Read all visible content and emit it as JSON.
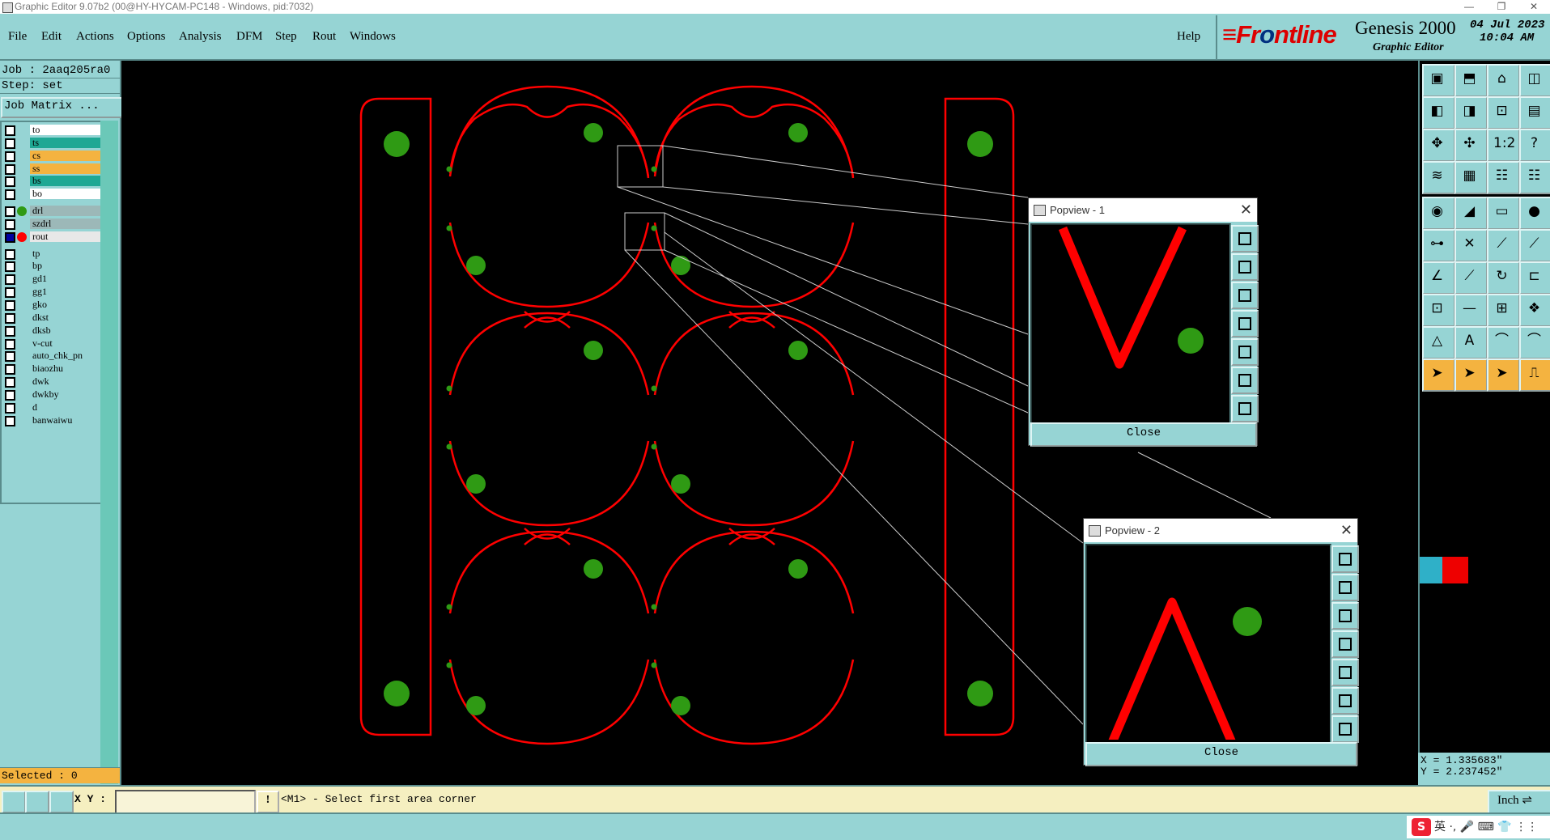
{
  "window": {
    "title": "Graphic Editor 9.07b2 (00@HY-HYCAM-PC148 - Windows, pid:7032)",
    "controls": [
      "—",
      "❐",
      "✕"
    ]
  },
  "menubar": {
    "items": [
      "File",
      "Edit",
      "Actions",
      "Options",
      "Analysis",
      "DFM",
      "Step",
      "Rout",
      "Windows"
    ],
    "help": "Help"
  },
  "logo": {
    "brand_a": "Fr",
    "brand_o": "o",
    "brand_b": "ntline",
    "product": "Genesis 2000",
    "subtitle": "Graphic Editor",
    "date": "04 Jul 2023",
    "time": "10:04 AM"
  },
  "job": {
    "job_line": "Job : 2aaq205ra0",
    "step_line": "Step: set",
    "job_matrix_label": "Job Matrix ..."
  },
  "layers": [
    {
      "name": "to",
      "bg": "#ffffff",
      "dot": ""
    },
    {
      "name": "ts",
      "bg": "#1fa894",
      "dot": ""
    },
    {
      "name": "cs",
      "bg": "#f4b340",
      "dot": ""
    },
    {
      "name": "ss",
      "bg": "#f4b340",
      "dot": ""
    },
    {
      "name": "bs",
      "bg": "#1fa894",
      "dot": ""
    },
    {
      "name": "bo",
      "bg": "#ffffff",
      "dot": ""
    },
    {
      "name": "drl",
      "bg": "#9cb8b8",
      "dot": "#2f9a14"
    },
    {
      "name": "szdrl",
      "bg": "#9cb8b8",
      "dot": ""
    },
    {
      "name": "rout",
      "bg": "#e8e8e8",
      "dot": "#ff0000",
      "active": true
    },
    {
      "name": "tp",
      "bg": "#96d4d4",
      "dot": ""
    },
    {
      "name": "bp",
      "bg": "#96d4d4",
      "dot": ""
    },
    {
      "name": "gd1",
      "bg": "#96d4d4",
      "dot": ""
    },
    {
      "name": "gg1",
      "bg": "#96d4d4",
      "dot": ""
    },
    {
      "name": "gko",
      "bg": "#96d4d4",
      "dot": ""
    },
    {
      "name": "dkst",
      "bg": "#96d4d4",
      "dot": ""
    },
    {
      "name": "dksb",
      "bg": "#96d4d4",
      "dot": ""
    },
    {
      "name": "v-cut",
      "bg": "#96d4d4",
      "dot": ""
    },
    {
      "name": "auto_chk_pn",
      "bg": "#96d4d4",
      "dot": ""
    },
    {
      "name": "biaozhu",
      "bg": "#96d4d4",
      "dot": ""
    },
    {
      "name": "dwk",
      "bg": "#96d4d4",
      "dot": ""
    },
    {
      "name": "dwkby",
      "bg": "#96d4d4",
      "dot": ""
    },
    {
      "name": "d",
      "bg": "#96d4d4",
      "dot": ""
    },
    {
      "name": "banwaiwu",
      "bg": "#96d4d4",
      "dot": ""
    }
  ],
  "selected": "Selected : 0",
  "popview1": {
    "title": "Popview - 1",
    "close": "Close"
  },
  "popview2": {
    "title": "Popview - 2",
    "close": "Close"
  },
  "coords": {
    "x": "X = 1.335683\"",
    "y": "Y = 2.237452\""
  },
  "cmdbar": {
    "xy_label": "X Y :",
    "xy_value": "",
    "excl": "!",
    "prompt": "<M1> - Select first area corner",
    "unit": "Inch ⇌"
  },
  "ime": {
    "logo": "S",
    "text": "英 ·, 🎤 ⌨ 👕 ⋮⋮"
  },
  "colors": {
    "route": "#ff0000",
    "drill": "#2f9a14",
    "panel": "#96d4d4"
  }
}
